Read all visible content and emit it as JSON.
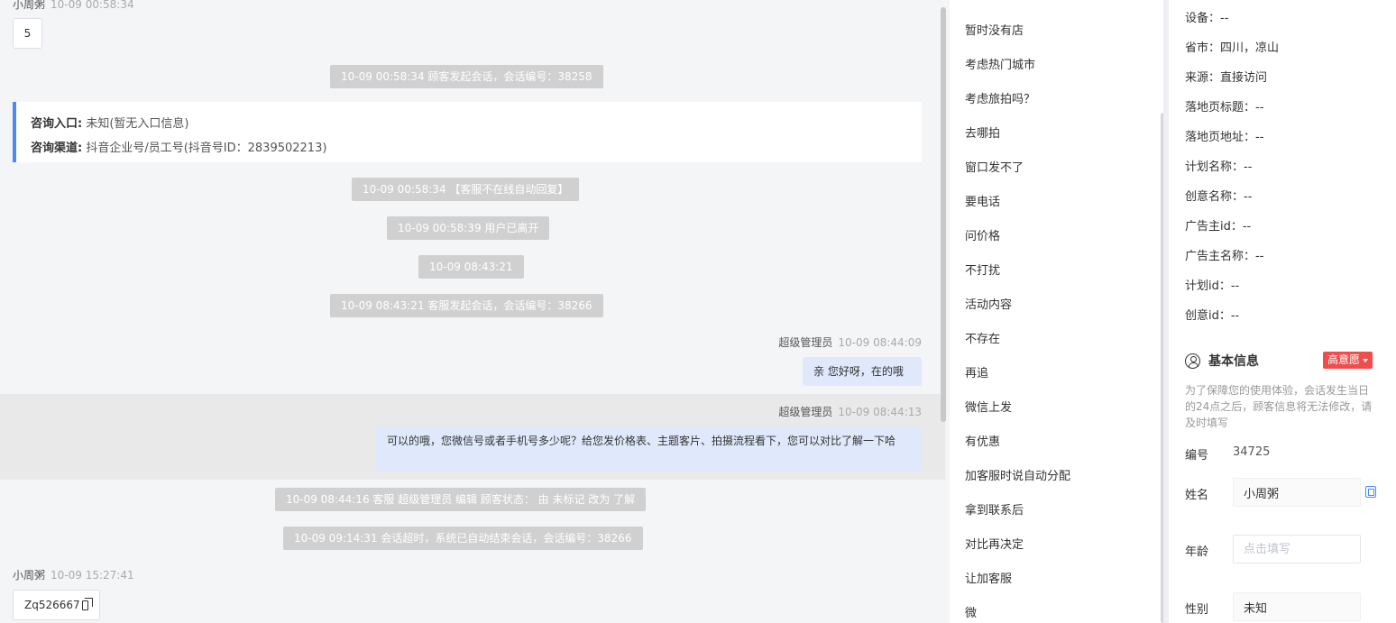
{
  "chat": {
    "top_sender": "小周粥",
    "top_time": "10-09 00:58:34",
    "top_msg": "5",
    "sys1": "10-09 00:58:34 顾客发起会话，会话编号：38258",
    "entry_label": "咨询入口:",
    "entry_value": "未知(暂无入口信息)",
    "channel_label": "咨询渠道:",
    "channel_value": "抖音企业号/员工号(抖音号ID：2839502213)",
    "sys2": "10-09 00:58:34 【客服不在线自动回复】",
    "sys3": "10-09 00:58:39 用户已离开",
    "sys4": "10-09 08:43:21",
    "sys5": "10-09 08:43:21 客服发起会话，会话编号：38266",
    "agent_name": "超级管理员",
    "agent_time1": "10-09 08:44:09",
    "agent_msg1": "亲 您好呀，在的哦",
    "agent_time2": "10-09 08:44:13",
    "agent_msg2": "可以的哦，您微信号或者手机号多少呢？给您发价格表、主题客片、拍摄流程看下，您可以对比了解一下哈",
    "sys6": "10-09 08:44:16 客服 超级管理员 编辑 顾客状态： 由 未标记 改为 了解",
    "sys7": "10-09 09:14:31 会话超时，系统已自动结束会话，会话编号：38266",
    "bottom_sender": "小周粥",
    "bottom_time": "10-09 15:27:41",
    "bottom_msg": "Zq526667"
  },
  "quick_replies": [
    "暂时没有店",
    "考虑热门城市",
    "考虑旅拍吗？",
    "去哪拍",
    "窗口发不了",
    "要电话",
    "问价格",
    "不打扰",
    "活动内容",
    "不存在",
    "再追",
    "微信上发",
    "有优惠",
    "加客服时说自动分配",
    "拿到联系后",
    "对比再决定",
    "让加客服",
    "微"
  ],
  "info": {
    "rows": [
      "设备：--",
      "省市：四川，凉山",
      "来源：直接访问",
      "落地页标题：--",
      "落地页地址：--",
      "计划名称：--",
      "创意名称：--",
      "广告主id：--",
      "广告主名称：--",
      "计划id：--",
      "创意id：--"
    ],
    "basic_title": "基本信息",
    "tag": "高意愿",
    "notice": "为了保障您的使用体验，会话发生当日的24点之后，顾客信息将无法修改，请及时填写",
    "id_label": "编号",
    "id_value": "34725",
    "name_label": "姓名",
    "name_value": "小周粥",
    "age_label": "年龄",
    "age_placeholder": "点击填写",
    "gender_label": "性别",
    "gender_value": "未知"
  }
}
